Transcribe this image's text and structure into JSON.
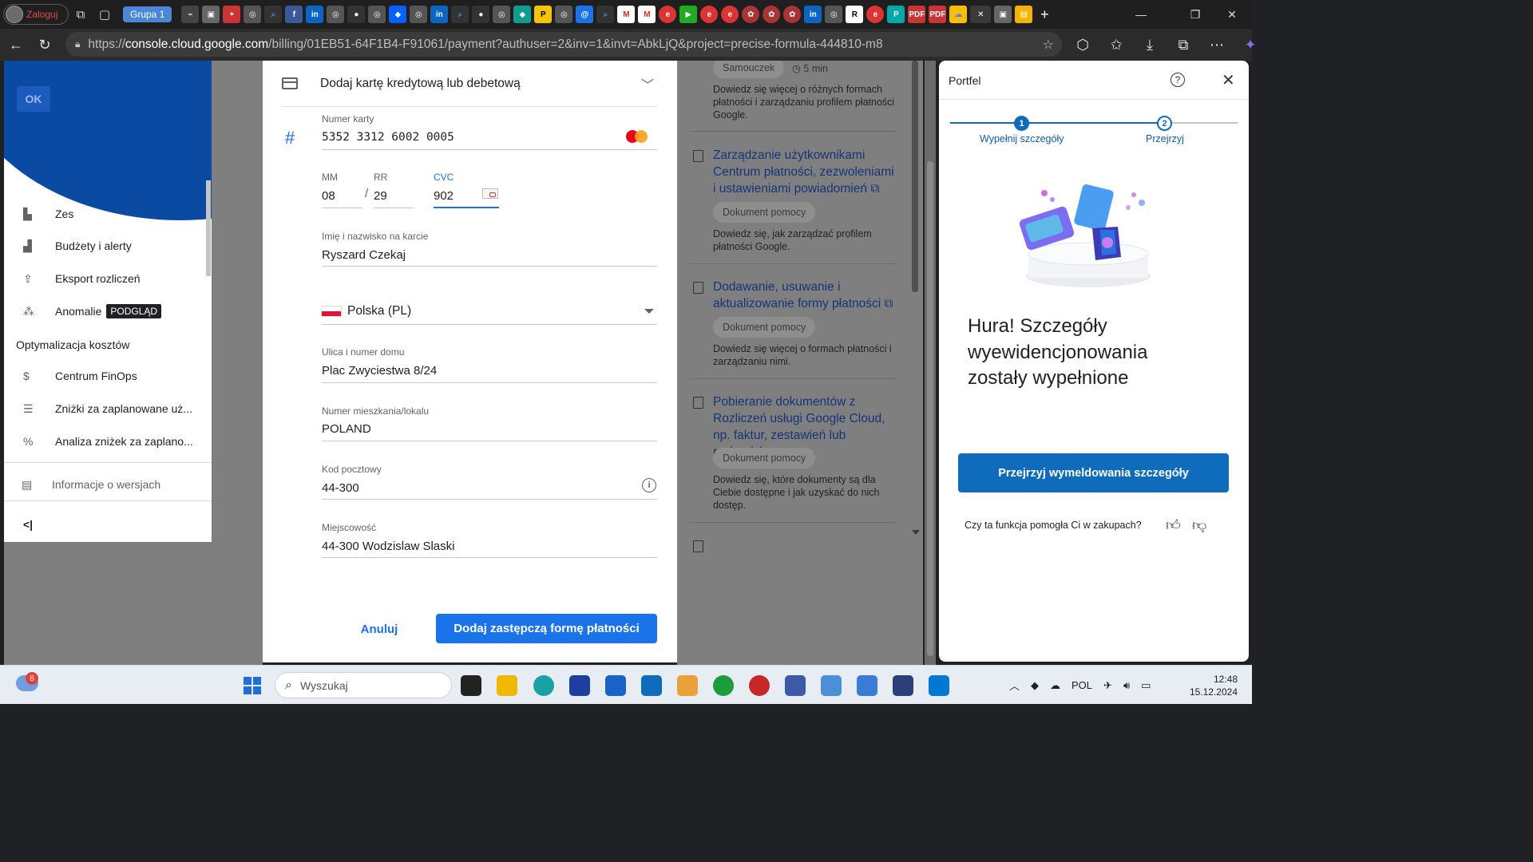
{
  "browser": {
    "profile_label": "Zaloguj",
    "tab_group": "Grupa 1",
    "url_prefix": "https://",
    "url_host": "console.cloud.google.com",
    "url_path": "/billing/01EB51-64F1B4-F91061/payment?authuser=2&inv=1&invt=AbkLjQ&project=precise-formula-444810-m8"
  },
  "sidebar": {
    "ok_label": "OK",
    "items": [
      {
        "label": "Zes",
        "icon": "reports-icon"
      },
      {
        "label": "Budżety i alerty",
        "icon": "budget-icon"
      },
      {
        "label": "Eksport rozliczeń",
        "icon": "export-icon"
      },
      {
        "label": "Anomalie",
        "icon": "anomaly-icon",
        "badge": "PODGLĄD"
      }
    ],
    "section_label": "Optymalizacja kosztów",
    "opt_items": [
      {
        "label": "Centrum FinOps",
        "icon": "finops-icon"
      },
      {
        "label": "Zniżki za zaplanowane uż...",
        "icon": "list-icon"
      },
      {
        "label": "Analiza zniżek za zaplano...",
        "icon": "percent-icon"
      }
    ],
    "release_notes": "Informacje o wersjach",
    "collapse_glyph": "<|"
  },
  "payment_form": {
    "title": "Dodaj kartę kredytową lub debetową",
    "card_number_label": "Numer karty",
    "card_number": "5352  3312  6002  0005",
    "mm_label": "MM",
    "mm": "08",
    "yy_label": "RR",
    "yy": "29",
    "separator": "/",
    "cvc_label": "CVC",
    "cvc": "902",
    "name_label": "Imię i nazwisko na karcie",
    "name": "Ryszard Czekaj",
    "country": "Polska (PL)",
    "street_label": "Ulica i numer domu",
    "street": "Plac Zwyciestwa 8/24",
    "apt_label": "Numer mieszkania/lokalu",
    "apt": "POLAND",
    "postal_label": "Kod pocztowy",
    "postal": "44-300",
    "city_label": "Miejscowość",
    "city": "44-300 Wodzislaw Slaski",
    "cancel_label": "Anuluj",
    "submit_label": "Dodaj zastępczą formę płatności"
  },
  "help_panel": {
    "top_chip": "Samouczek",
    "top_time": "5 min",
    "top_desc": "Dowiedz się więcej o różnych formach płatności i zarządzaniu profilem płatności Google.",
    "cards": [
      {
        "title": "Zarządzanie użytkownikami Centrum płatności, zezwoleniami i ustawieniami powiadomień",
        "chip": "Dokument pomocy",
        "desc": "Dowiedz się, jak zarządzać profilem płatności Google."
      },
      {
        "title": "Dodawanie, usuwanie i aktualizowanie formy płatności",
        "chip": "Dokument pomocy",
        "desc": "Dowiedz się więcej o formach płatności i zarządzaniu nimi."
      },
      {
        "title": "Pobieranie dokumentów z Rozliczeń usługi Google Cloud, np. faktur, zestawień lub rachunków",
        "chip": "Dokument pomocy",
        "desc": "Dowiedz się, które dokumenty są dla Ciebie dostępne i jak uzyskać do nich dostęp."
      }
    ]
  },
  "wallet": {
    "title": "Portfel",
    "step1": "Wypełnij szczegóły",
    "step2": "Przejrzyj",
    "step1_num": "1",
    "step2_num": "2",
    "headline": "Hura! Szczegóły wyewidencjonowania zostały wypełnione",
    "button": "Przejrzyj wymeldowania szczegóły",
    "feedback": "Czy ta funkcja pomogła Ci w zakupach?"
  },
  "taskbar": {
    "weather_badge": "8",
    "search_placeholder": "Wyszukaj",
    "language": "POL",
    "time": "12:48",
    "date": "15.12.2024"
  },
  "colors": {
    "gcp_blue": "#1a73e8",
    "wallet_blue": "#0f6cbd",
    "mastercard_red": "#eb001b",
    "mastercard_orange": "#f79e1b"
  }
}
